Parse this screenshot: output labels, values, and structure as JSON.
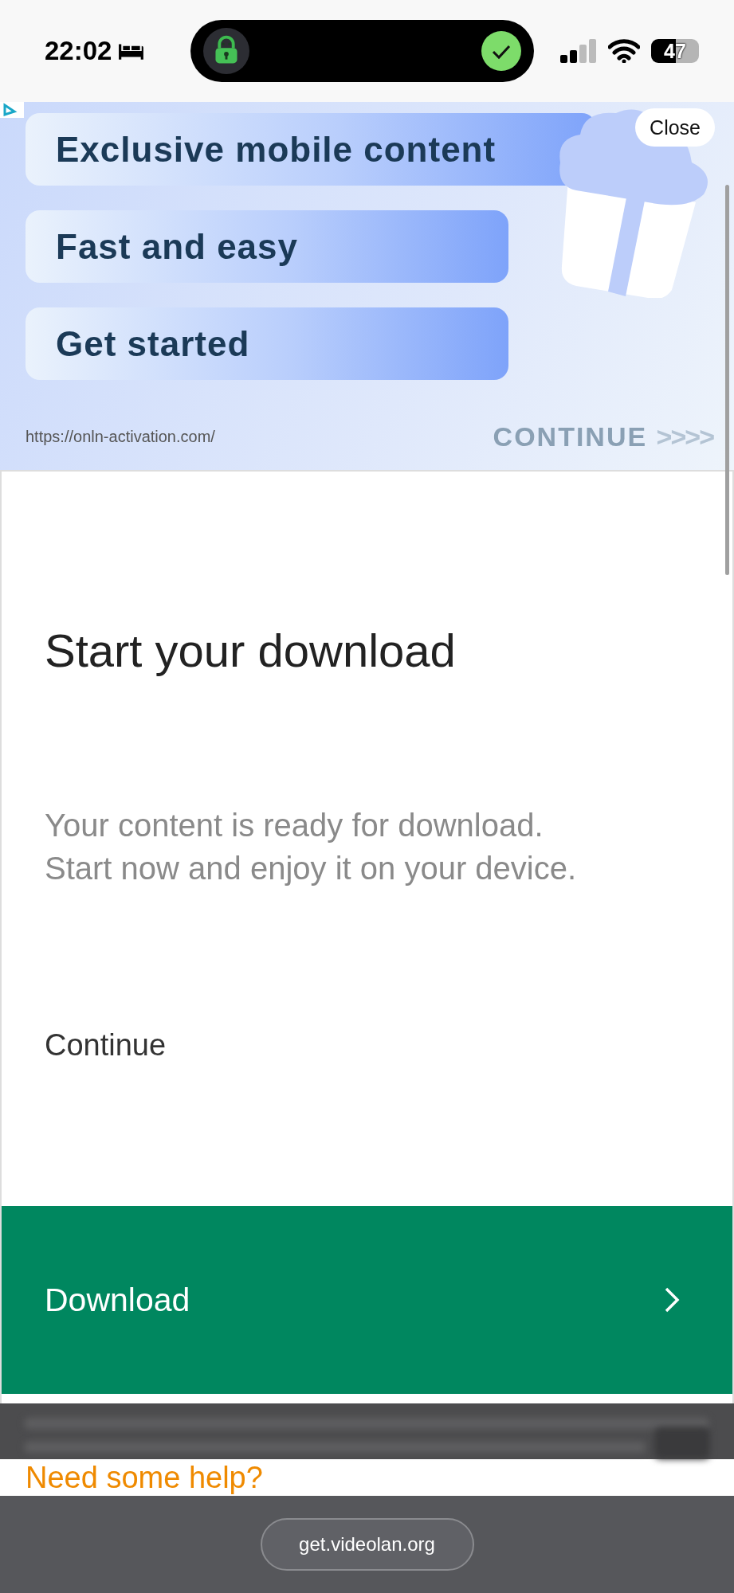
{
  "status_bar": {
    "time": "22:02",
    "battery": "47"
  },
  "ad": {
    "bands": [
      "Exclusive mobile content",
      "Fast and easy",
      "Get started"
    ],
    "url": "https://onln-activation.com/",
    "cta": "CONTINUE",
    "cta_arrows": ">>>>",
    "close": "Close"
  },
  "main": {
    "title": "Start your download",
    "description": [
      "Your content is ready for download.",
      "Start now and enjoy it on your device."
    ],
    "link": "Continue",
    "button": "Download"
  },
  "help_heading": "Need some help?",
  "address_bar": {
    "url": "get.videolan.org"
  }
}
